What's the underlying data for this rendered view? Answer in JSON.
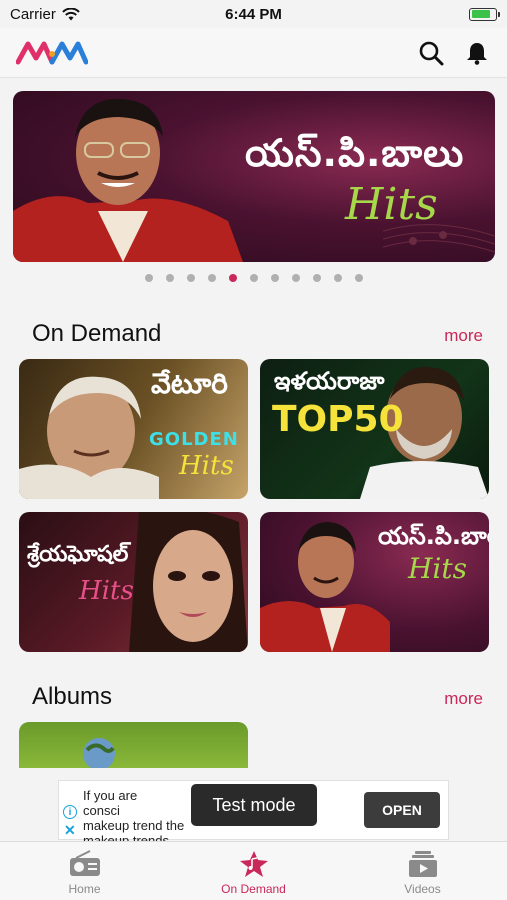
{
  "status_bar": {
    "carrier": "Carrier",
    "time": "6:44 PM"
  },
  "header": {
    "search_icon": "search-icon",
    "bell_icon": "bell-icon"
  },
  "banner": {
    "title_te": "యస్.పి.బాలు",
    "subtitle": "Hits",
    "page_count": 11,
    "active_page": 5
  },
  "on_demand": {
    "title": "On Demand",
    "more_label": "more",
    "cards": [
      {
        "title_te": "వేటూరి",
        "title_en": "GOLDEN",
        "subtitle": "Hits"
      },
      {
        "title_te": "ఇళయరాజా",
        "title_en": "TOP50"
      },
      {
        "title_te": "శ్రేయఘోషల్",
        "subtitle": "Hits"
      },
      {
        "title_te": "యస్.పి.బాలు",
        "subtitle": "Hits"
      }
    ]
  },
  "albums": {
    "title": "Albums",
    "more_label": "more"
  },
  "ad": {
    "text": "If you are conscious about makeup trend the... makeup trends.",
    "text_line1": "If you are consci",
    "text_line1_tail": "d",
    "text_line2": "makeup trend the",
    "text_line3": "makeup trends.",
    "cta": "OPEN",
    "test_badge": "Test mode"
  },
  "tabs": [
    {
      "label": "Home",
      "icon": "radio-icon",
      "active": false
    },
    {
      "label": "On Demand",
      "icon": "star-note-icon",
      "active": true
    },
    {
      "label": "Videos",
      "icon": "video-stack-icon",
      "active": false
    }
  ],
  "colors": {
    "accent": "#c8285a",
    "hits_green": "#a6d84a",
    "golden_cyan": "#3ee0e8",
    "top50_yellow": "#f5e23a"
  }
}
